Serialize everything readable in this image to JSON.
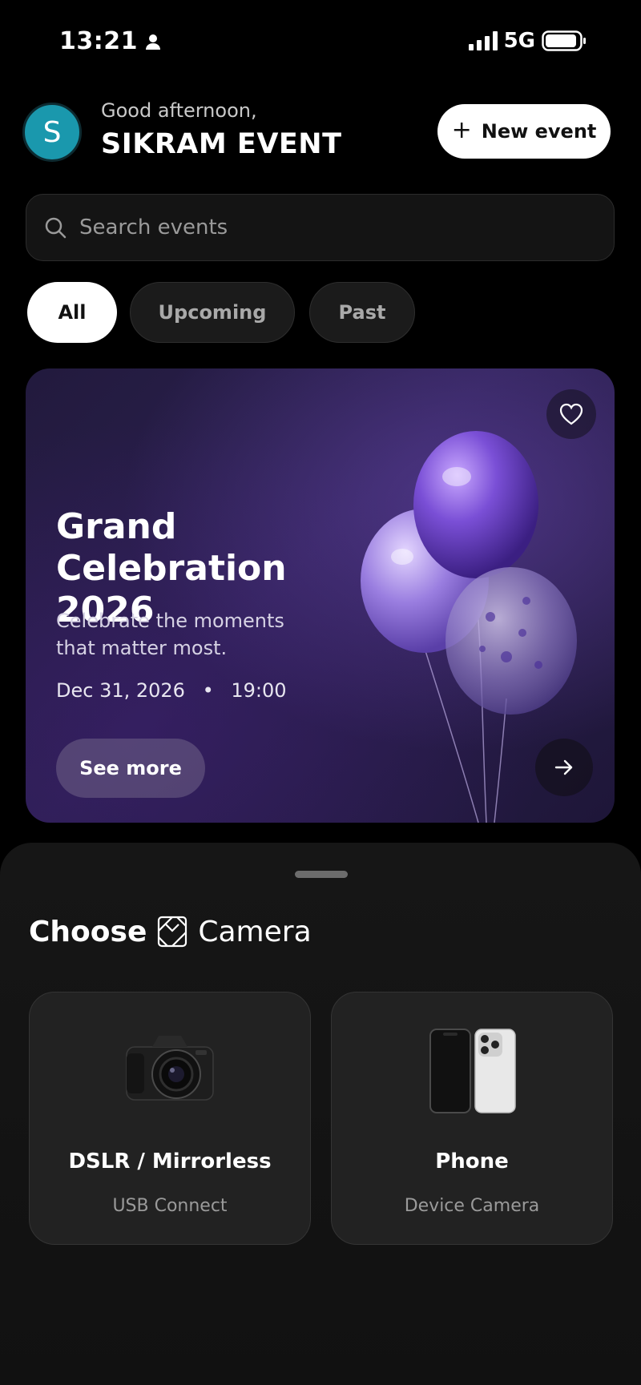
{
  "status_bar": {
    "time": "13:21",
    "network": "5G",
    "battery_level": 0.85
  },
  "header": {
    "avatar_initial": "S",
    "greeting": "Good afternoon,",
    "title": "SIKRAM EVENT",
    "new_event_label": "New event"
  },
  "search": {
    "placeholder": "Search events"
  },
  "filters": {
    "all": "All",
    "upcoming": "Upcoming",
    "past": "Past",
    "selected": "All"
  },
  "event_card": {
    "title": "Grand Celebration 2026",
    "subtitle": "Celebrate the moments that matter most.",
    "date": "Dec 31, 2026",
    "separator": "•",
    "time": "19:00",
    "cta": "See more"
  },
  "camera_sheet": {
    "title_prefix": "Choose",
    "title_suffix": "Camera",
    "options": [
      {
        "title": "DSLR / Mirrorless",
        "subtitle": "USB Connect",
        "icon": "dslr-camera-icon"
      },
      {
        "title": "Phone",
        "subtitle": "Device Camera",
        "icon": "smartphone-icon"
      }
    ]
  },
  "colors": {
    "accent_avatar": "#1a98ad",
    "background": "#000000",
    "card_purple": "#2b2050"
  }
}
